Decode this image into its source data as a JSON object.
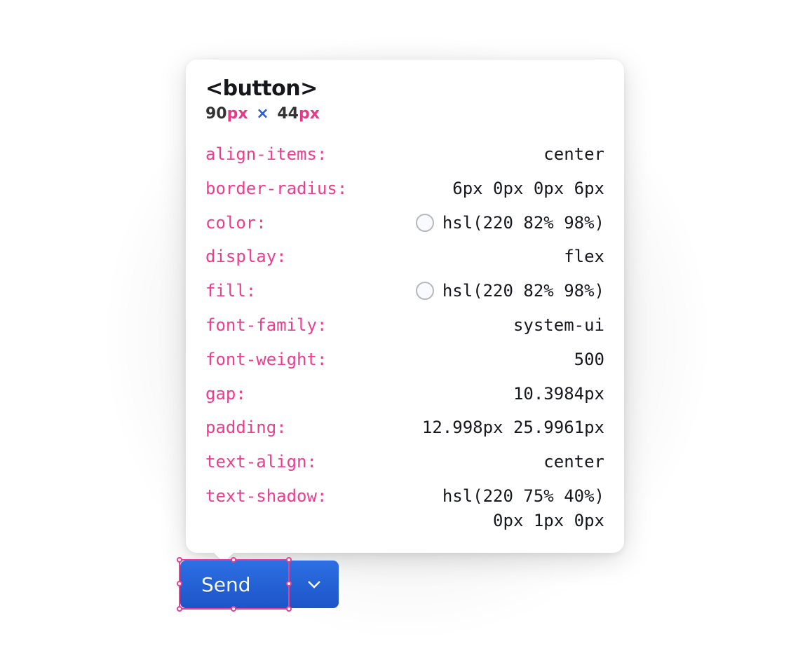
{
  "tooltip": {
    "element_tag": "<button>",
    "dimensions": {
      "width": "90",
      "width_unit": "px",
      "times": "×",
      "height": "44",
      "height_unit": "px"
    },
    "properties": [
      {
        "name": "align-items:",
        "value": "center",
        "has_swatch": false
      },
      {
        "name": "border-radius:",
        "value": "6px 0px 0px 6px",
        "has_swatch": false
      },
      {
        "name": "color:",
        "value": "hsl(220 82% 98%)",
        "has_swatch": true
      },
      {
        "name": "display:",
        "value": "flex",
        "has_swatch": false
      },
      {
        "name": "fill:",
        "value": "hsl(220 82% 98%)",
        "has_swatch": true
      },
      {
        "name": "font-family:",
        "value": "system-ui",
        "has_swatch": false
      },
      {
        "name": "font-weight:",
        "value": "500",
        "has_swatch": false
      },
      {
        "name": "gap:",
        "value": "10.3984px",
        "has_swatch": false
      },
      {
        "name": "padding:",
        "value": "12.998px 25.9961px",
        "has_swatch": false
      },
      {
        "name": "text-align:",
        "value": "center",
        "has_swatch": false
      },
      {
        "name": "text-shadow:",
        "value": "hsl(220 75% 40%)\n0px 1px 0px",
        "has_swatch": false
      }
    ]
  },
  "buttons": {
    "send_label": "Send"
  }
}
